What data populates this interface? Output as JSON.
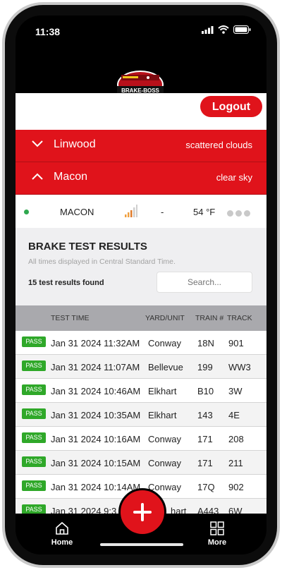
{
  "status_bar": {
    "time": "11:38"
  },
  "brand": {
    "logo_text": "BRAKE-BOSS"
  },
  "header": {
    "logout_label": "Logout"
  },
  "locations": [
    {
      "name": "Linwood",
      "weather": "scattered clouds",
      "expanded": false
    },
    {
      "name": "Macon",
      "weather": "clear sky",
      "expanded": true
    }
  ],
  "location_detail": {
    "name": "MACON",
    "dash": "-",
    "temperature": "54 °F"
  },
  "results": {
    "title": "BRAKE TEST RESULTS",
    "note": "All times displayed in Central Standard Time.",
    "count_text": "15 test results found",
    "search_placeholder": "Search..."
  },
  "table": {
    "headers": [
      "TEST TIME",
      "YARD/UNIT",
      "TRAIN #",
      "TRACK"
    ],
    "rows": [
      {
        "status": "PASS",
        "time": "Jan 31 2024 11:32AM",
        "yard": "Conway",
        "train": "18N",
        "track": "901"
      },
      {
        "status": "PASS",
        "time": "Jan 31 2024 11:07AM",
        "yard": "Bellevue",
        "train": "199",
        "track": "WW3"
      },
      {
        "status": "PASS",
        "time": "Jan 31 2024 10:46AM",
        "yard": "Elkhart",
        "train": "B10",
        "track": "3W"
      },
      {
        "status": "PASS",
        "time": "Jan 31 2024 10:35AM",
        "yard": "Elkhart",
        "train": "143",
        "track": "4E"
      },
      {
        "status": "PASS",
        "time": "Jan 31 2024 10:16AM",
        "yard": "Conway",
        "train": "171",
        "track": "208"
      },
      {
        "status": "PASS",
        "time": "Jan 31 2024 10:15AM",
        "yard": "Conway",
        "train": "171",
        "track": "211"
      },
      {
        "status": "PASS",
        "time": "Jan 31 2024 10:14AM",
        "yard": "Conway",
        "train": "17Q",
        "track": "902"
      },
      {
        "status": "PASS",
        "time": "Jan 31 2024  9:3",
        "yard": "hart",
        "train": "A443",
        "track": "6W"
      }
    ]
  },
  "tabbar": {
    "home_label": "Home",
    "more_label": "More"
  },
  "colors": {
    "brand_red": "#e0131b",
    "pass_green": "#2fa829",
    "online_green": "#2fa84f"
  }
}
